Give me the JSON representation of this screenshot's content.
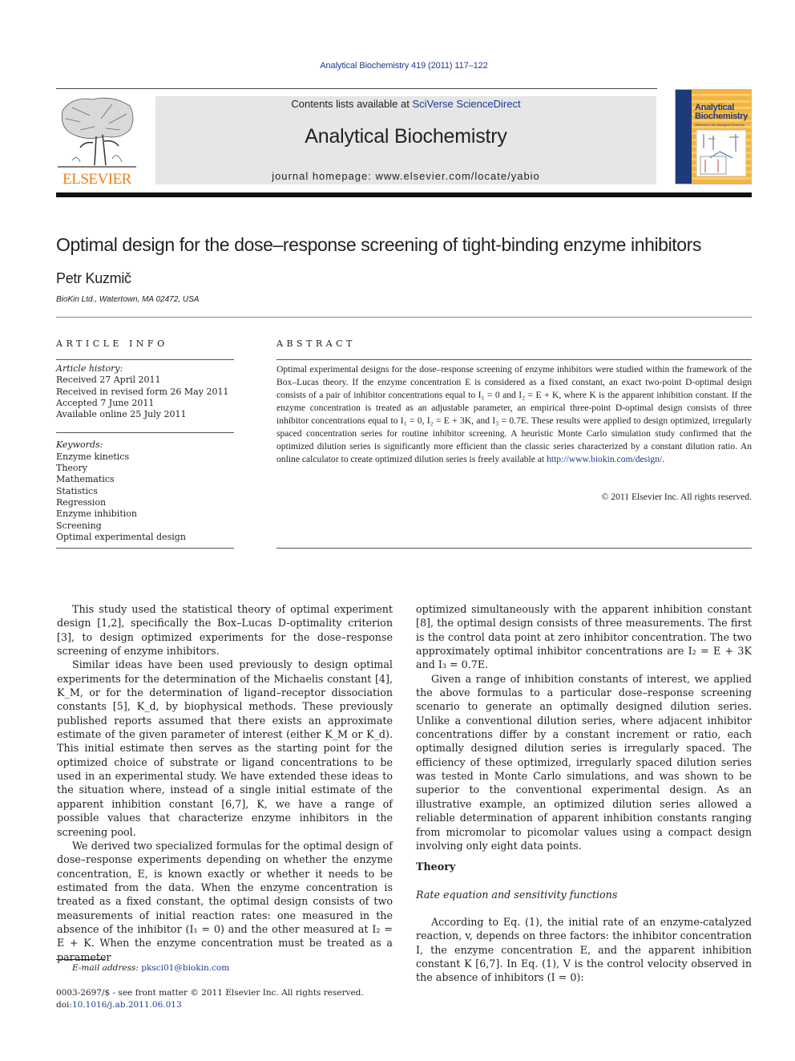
{
  "header": {
    "citation": "Analytical Biochemistry 419 (2011) 117–122",
    "contents_prefix": "Contents lists available at ",
    "contents_link": "SciVerse ScienceDirect",
    "journal_name": "Analytical Biochemistry",
    "homepage": "journal homepage: www.elsevier.com/locate/yabio",
    "publisher_logo_text": "ELSEVIER",
    "cover_title_line1": "Analytical",
    "cover_title_line2": "Biochemistry",
    "cover_subtitle": "Methods in the Biological Sciences",
    "colors": {
      "publisher_orange": "#f07d1b",
      "link_blue": "#1a3b8f",
      "masthead_gray": "#e6e6e6",
      "cover_navy": "#1f3a7a",
      "cover_gold": "#f4b33f"
    }
  },
  "article": {
    "title": "Optimal design for the dose–response screening of tight-binding enzyme inhibitors",
    "author": "Petr Kuzmič",
    "affiliation": "BioKin Ltd., Watertown, MA 02472, USA"
  },
  "article_info": {
    "label": "ARTICLE INFO",
    "history_heading": "Article history:",
    "history": [
      "Received 27 April 2011",
      "Received in revised form 26 May 2011",
      "Accepted 7 June 2011",
      "Available online 25 July 2011"
    ],
    "keywords_heading": "Keywords:",
    "keywords": [
      "Enzyme kinetics",
      "Theory",
      "Mathematics",
      "Statistics",
      "Regression",
      "Enzyme inhibition",
      "Screening",
      "Optimal experimental design"
    ]
  },
  "abstract": {
    "label": "ABSTRACT",
    "text_part1": "Optimal experimental designs for the dose–response screening of enzyme inhibitors were studied within the framework of the Box–Lucas theory. If the enzyme concentration E is considered as a fixed constant, an exact two-point D-optimal design consists of a pair of inhibitor concentrations equal to I₁ = 0 and I₂ = E + K, where K is the apparent inhibition constant. If the enzyme concentration is treated as an adjustable parameter, an empirical three-point D-optimal design consists of three inhibitor concentrations equal to I₁ = 0, I₂ = E + 3K, and I₃ = 0.7E. These results were applied to design optimized, irregularly spaced concentration series for routine inhibitor screening. A heuristic Monte Carlo simulation study confirmed that the optimized dilution series is significantly more efficient than the classic series characterized by a constant dilution ratio. An online calculator to create optimized dilution series is freely available at ",
    "url": "http://www.biokin.com/design/",
    "text_part2": ".",
    "copyright": "© 2011 Elsevier Inc. All rights reserved."
  },
  "body": {
    "left": {
      "p1": "This study used the statistical theory of optimal experiment design [1,2], specifically the Box–Lucas D-optimality criterion [3], to design optimized experiments for the dose–response screening of enzyme inhibitors.",
      "p2": "Similar ideas have been used previously to design optimal experiments for the determination of the Michaelis constant [4], K_M, or for the determination of ligand–receptor dissociation constants [5], K_d, by biophysical methods. These previously published reports assumed that there exists an approximate estimate of the given parameter of interest (either K_M or K_d). This initial estimate then serves as the starting point for the optimized choice of substrate or ligand concentrations to be used in an experimental study. We have extended these ideas to the situation where, instead of a single initial estimate of the apparent inhibition constant [6,7], K, we have a range of possible values that characterize enzyme inhibitors in the screening pool.",
      "p3": "We derived two specialized formulas for the optimal design of dose–response experiments depending on whether the enzyme concentration, E, is known exactly or whether it needs to be estimated from the data. When the enzyme concentration is treated as a fixed constant, the optimal design consists of two measurements of initial reaction rates: one measured in the absence of the inhibitor (I₁ = 0) and the other measured at I₂ = E + K. When the enzyme concentration must be treated as a parameter"
    },
    "right": {
      "p1": "optimized simultaneously with the apparent inhibition constant [8], the optimal design consists of three measurements. The first is the control data point at zero inhibitor concentration. The two approximately optimal inhibitor concentrations are I₂ = E + 3K and I₃ = 0.7E.",
      "p2": "Given a range of inhibition constants of interest, we applied the above formulas to a particular dose–response screening scenario to generate an optimally designed dilution series. Unlike a conventional dilution series, where adjacent inhibitor concentrations differ by a constant increment or ratio, each optimally designed dilution series is irregularly spaced. The efficiency of these optimized, irregularly spaced dilution series was tested in Monte Carlo simulations, and was shown to be superior to the conventional experimental design. As an illustrative example, an optimized dilution series allowed a reliable determination of apparent inhibition constants ranging from micromolar to picomolar values using a compact design involving only eight data points.",
      "section_heading": "Theory",
      "subsection_heading": "Rate equation and sensitivity functions",
      "p3": "According to Eq. (1), the initial rate of an enzyme-catalyzed reaction, v, depends on three factors: the inhibitor concentration I, the enzyme concentration E, and the apparent inhibition constant K [6,7]. In Eq. (1), V is the control velocity observed in the absence of inhibitors (I = 0):"
    },
    "refs": {
      "r12": "[1,2]",
      "r3": "[3]",
      "r4": "[4]",
      "r5": "[5]",
      "r67": "[6,7]",
      "r8": "[8]",
      "eq1": "(1)"
    }
  },
  "footer": {
    "email_label": "E-mail address:",
    "email": "pksci01@biokin.com",
    "front_matter": "0003-2697/$ - see front matter © 2011 Elsevier Inc. All rights reserved.",
    "doi_prefix": "doi:",
    "doi": "10.1016/j.ab.2011.06.013"
  }
}
